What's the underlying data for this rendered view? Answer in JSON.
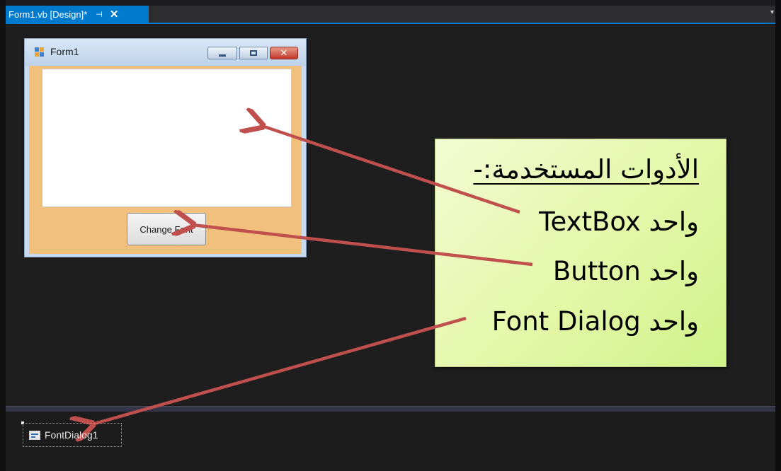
{
  "tab": {
    "title": "Form1.vb [Design]*",
    "pin_glyph": "⊣",
    "close_glyph": "✕",
    "dropdown_glyph": "▾"
  },
  "form": {
    "title": "Form1",
    "button_label": "Change Font",
    "close_glyph": "✕"
  },
  "callout": {
    "heading": "الأدوات المستخدمة:-",
    "line1": "واحد TextBox",
    "line2": "واحد Button",
    "line3": "واحد Font Dialog"
  },
  "tray": {
    "component_label": "FontDialog1"
  },
  "colors": {
    "accent": "#007acc",
    "arrow": "#c0504d",
    "form_client": "#f0c07c",
    "callout_fill": "#e4f7a8"
  }
}
